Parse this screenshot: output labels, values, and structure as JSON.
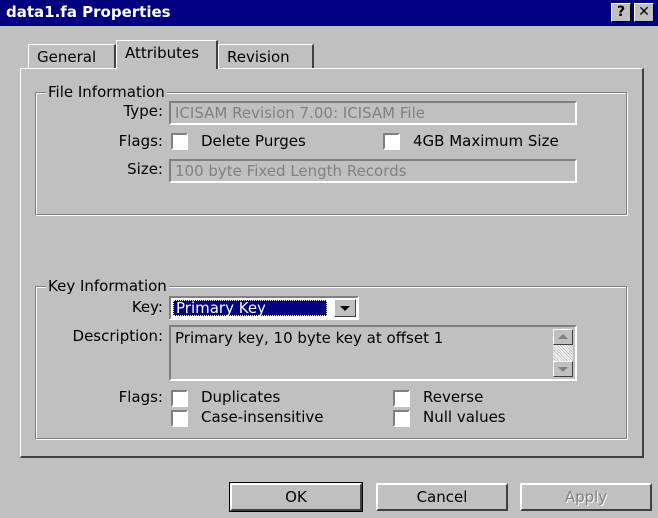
{
  "window": {
    "title": "data1.fa Properties",
    "help_glyph": "?",
    "close_glyph": "✕"
  },
  "tabs": [
    {
      "label": "General",
      "active": false
    },
    {
      "label": "Attributes",
      "active": true
    },
    {
      "label": "Revision",
      "active": false
    }
  ],
  "file_info": {
    "legend": "File Information",
    "type_label": "Type:",
    "type_value": "ICISAM Revision  7.00: ICISAM File",
    "flags_label": "Flags:",
    "flags": [
      {
        "label": "Delete Purges",
        "checked": false
      },
      {
        "label": "4GB Maximum Size",
        "checked": false
      }
    ],
    "size_label": "Size:",
    "size_value": "100 byte Fixed Length Records"
  },
  "key_info": {
    "legend": "Key Information",
    "key_label": "Key:",
    "key_value": "Primary Key",
    "description_label": "Description:",
    "description_value": "Primary key, 10 byte key at offset 1",
    "flags_label": "Flags:",
    "flags": [
      {
        "label": "Duplicates",
        "checked": false
      },
      {
        "label": "Reverse",
        "checked": false
      },
      {
        "label": "Case-insensitive",
        "checked": false
      },
      {
        "label": "Null values",
        "checked": false
      }
    ]
  },
  "buttons": {
    "ok": "OK",
    "cancel": "Cancel",
    "apply": "Apply"
  },
  "colors": {
    "titlebar": "#000080",
    "face": "#c0c0c0",
    "selection": "#000080",
    "disabled_text": "#808080"
  }
}
